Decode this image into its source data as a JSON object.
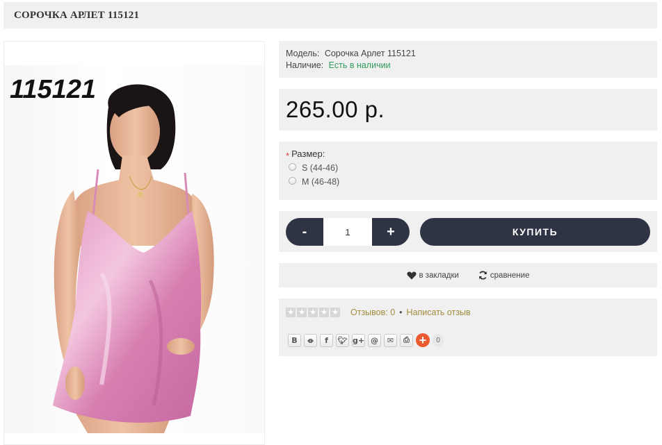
{
  "product": {
    "title": "СОРОЧКА АРЛЕТ 115121",
    "image_code": "115121"
  },
  "info": {
    "model_label": "Модель:",
    "model_value": "Сорочка Арлет 115121",
    "stock_label": "Наличие:",
    "stock_value": "Есть в наличии"
  },
  "price": "265.00 р.",
  "options": {
    "required_mark": "*",
    "label": "Размер:",
    "choices": [
      "S (44-46)",
      "M (46-48)"
    ]
  },
  "buy": {
    "minus_label": "-",
    "plus_label": "+",
    "quantity": "1",
    "buy_label": "КУПИТЬ"
  },
  "wish": {
    "bookmark_label": "в закладки",
    "compare_label": "сравнение"
  },
  "reviews": {
    "count_label": "Отзывов: 0",
    "separator": "•",
    "write_label": "Написать отзыв",
    "rating": 0,
    "max_rating": 5
  },
  "share": {
    "buttons": [
      "В",
      "ok",
      "f",
      "tw",
      "g+",
      "@",
      "mail",
      "print"
    ],
    "count": "0"
  },
  "colors": {
    "accent_dark": "#2f3444",
    "stock_green": "#2e9b5b",
    "link_gold": "#a08c3c",
    "panel_bg": "#f0f0f0",
    "share_plus": "#ec5a2f"
  }
}
